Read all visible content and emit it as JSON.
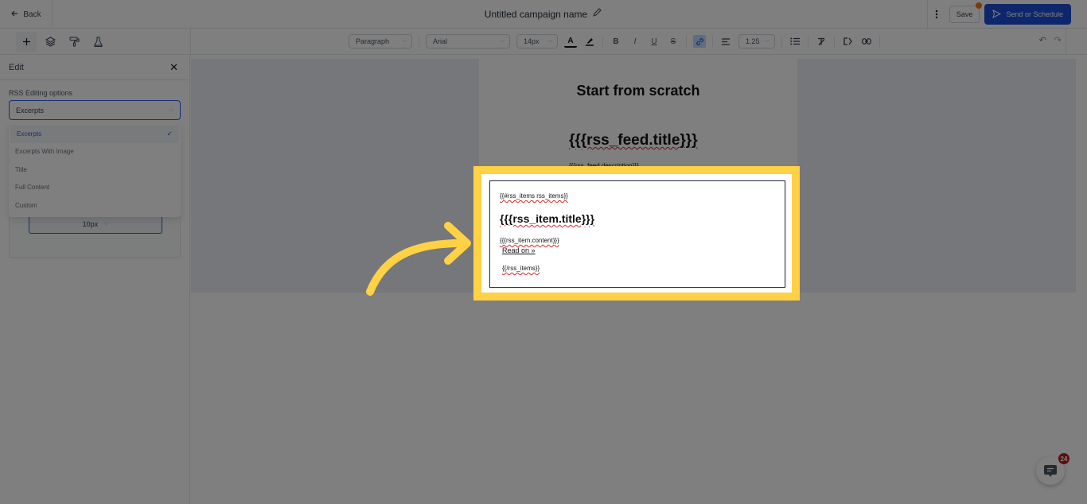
{
  "header": {
    "back_label": "Back",
    "campaign_title": "Untitled campaign name",
    "save_label": "Save",
    "send_label": "Send or Schedule"
  },
  "toolbar": {
    "left_tools": [
      "add-icon",
      "layers-icon",
      "paint-roller-icon",
      "flask-icon"
    ],
    "block_type": "Paragraph",
    "font_family": "Arial",
    "font_size": "14px",
    "line_height": "1.25",
    "text_color_glyph": "A",
    "bold_glyph": "B",
    "italic_glyph": "I",
    "underline_glyph": "U",
    "strike_glyph": "S",
    "undo_glyph": "↶",
    "redo_glyph": "↷"
  },
  "sidebar": {
    "title": "Edit",
    "rss_label": "RSS Editing options",
    "rss_selected": "Excerpts",
    "rss_options": [
      {
        "label": "Excerpts",
        "selected": true
      },
      {
        "label": "Excerpts With Image",
        "selected": false
      },
      {
        "label": "Title",
        "selected": false
      },
      {
        "label": "Full Content",
        "selected": false
      },
      {
        "label": "Custom",
        "selected": false
      }
    ],
    "padding_value": "10px"
  },
  "email": {
    "heading": "Start from scratch",
    "feed_title": "{{{rss_feed.title}}}",
    "feed_description": "{{{rss_feed.description}}}",
    "rss_block": {
      "open_tag": "{{#rss_items rss_items}}",
      "item_title": "{{{rss_item.title}}}",
      "item_content": "{{{rss_item.content}}}",
      "read_on": "Read on »",
      "close_tag": "{{/rss_items}}"
    }
  },
  "chat": {
    "badge_count": "24"
  },
  "colors": {
    "primary": "#1d4ed8",
    "highlight": "#ffd144",
    "notification_dot": "#f97316",
    "badge": "#b91c1c"
  }
}
